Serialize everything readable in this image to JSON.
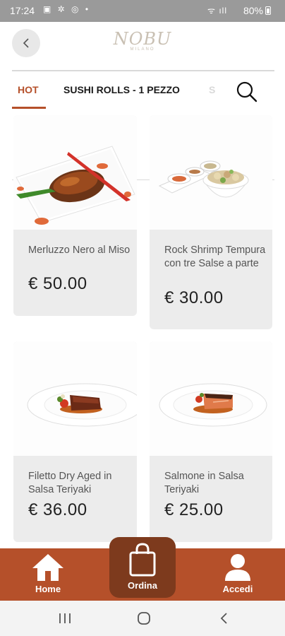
{
  "status_bar": {
    "time": "17:24",
    "icons": "▣ ✲ ◎ •",
    "signal": "ᯤ ıll",
    "battery": "80%"
  },
  "header": {
    "logo_brand": "NOBU",
    "logo_city": "MILANO",
    "back_icon": "chevron-left-icon"
  },
  "tabs": [
    {
      "label": "HOT"
    },
    {
      "label": "SUSHI ROLLS - 1 PEZZO"
    },
    {
      "label": "S"
    }
  ],
  "products": [
    {
      "name": "Merluzzo Nero al Miso",
      "price": "€ 50.00"
    },
    {
      "name": "Rock Shrimp Tempura con tre Salse a parte",
      "price": "€ 30.00"
    },
    {
      "name": "Filetto Dry Aged in Salsa Teriyaki",
      "price": "€ 36.00"
    },
    {
      "name": "Salmone in Salsa Teriyaki",
      "price": "€ 25.00"
    }
  ],
  "bottom_nav": {
    "home": "Home",
    "order": "Ordina",
    "login": "Accedi"
  },
  "colors": {
    "accent": "#b5502a",
    "accent_dark": "#7d3a1d",
    "card_bg": "#ececec"
  }
}
